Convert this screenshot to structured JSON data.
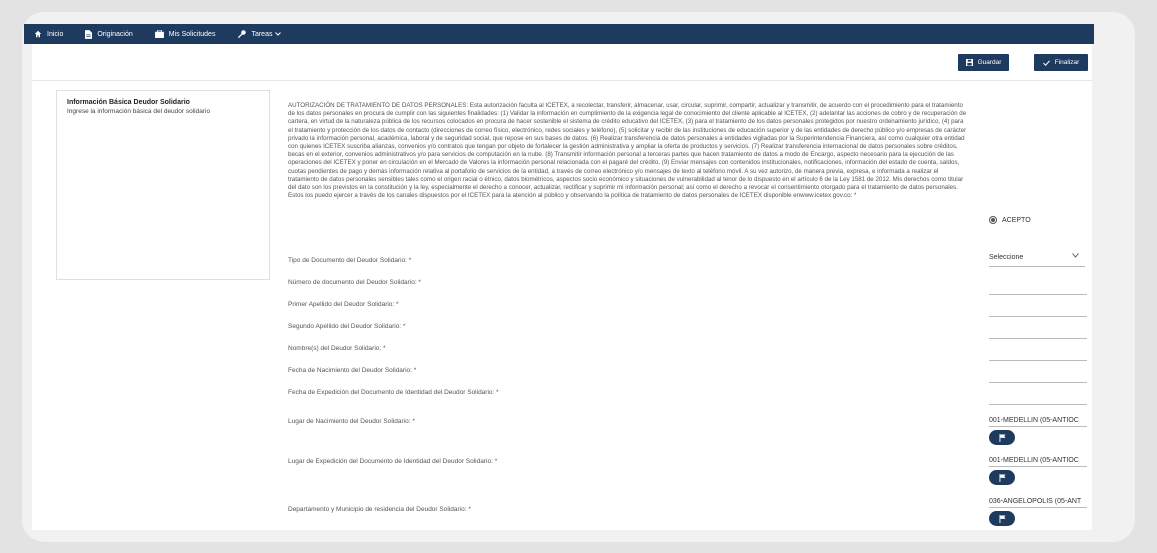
{
  "nav": {
    "items": [
      {
        "label": "Inicio",
        "icon": "home-icon"
      },
      {
        "label": "Originación",
        "icon": "document-icon"
      },
      {
        "label": "Mis Solicitudes",
        "icon": "briefcase-icon"
      },
      {
        "label": "Tareas",
        "icon": "wrench-icon"
      }
    ]
  },
  "toolbar": {
    "save_label": "Guardar",
    "finish_label": "Finalizar"
  },
  "section": {
    "title": "Información Básica Deudor Solidario",
    "subtitle": "Ingrese la información básica del deudor solidario"
  },
  "authorization": {
    "text": "AUTORIZACIÓN DE TRATAMIENTO DE DATOS PERSONALES: Esta autorización faculta al ICETEX, a recolectar, transferir, almacenar, usar, circular, suprimir, compartir, actualizar y transmitir, de acuerdo con el procedimiento para el tratamiento de los datos personales en procura de cumplir con las siguientes finalidades: (1) Validar la información en cumplimiento de la exigencia legal de conocimiento del cliente aplicable al ICETEX, (2) adelantar las acciones de cobro y de recuperación de cartera, en virtud de la naturaleza pública de los recursos colocados en procura de hacer sostenible el sistema de crédito educativo del ICETEX, (3) para el tratamiento de los datos personales protegidos por nuestro ordenamiento jurídico, (4) para el tratamiento y protección de los datos de contacto (direcciones de correo físico, electrónico, redes sociales y teléfono), (5) solicitar y recibir de las instituciones de educación superior y de las entidades de derecho público y/o empresas de carácter privado la información personal, académica, laboral y de seguridad social, que repose en sus bases de datos. (6) Realizar transferencia de datos personales a entidades vigiladas por la Superintendencia Financiera, así como cualquier otra entidad con quienes ICETEX suscriba alianzas, convenios y/o contratos que tengan por objeto de fortalecer la gestión administrativa y ampliar la oferta de productos y servicios. (7) Realizar transferencia internacional de datos personales sobre créditos, becas en el exterior, convenios administrativos y/o para servicios de computación en la nube. (8) Transmitir información personal a terceras partes que hacen tratamiento de datos a modo de Encargo, aspecto necesario para la ejecución de las operaciones del ICETEX y poner en circulación en el Mercado de Valores la información personal relacionada con el pagaré del crédito. (9) Enviar mensajes con contenidos institucionales, notificaciones, información del estado de cuenta, saldos, cuotas pendientes de pago y demás información relativa al portafolio de servicios de la entidad, a través de correo electrónico y/o mensajes de texto al teléfono móvil. A su vez autorizo, de manera previa, expresa, e informada a realizar el tratamiento de datos personales sensibles tales como el origen racial o étnico, datos biométricos, aspectos socio económico y situaciones de vulnerabilidad al tenor de lo dispuesto en el artículo 6 de la Ley 1581 de 2012. Mis derechos como titular del dato son los previstos en la constitución y la ley, especialmente el derecho a conocer, actualizar, rectificar y suprimir mi información personal; así como el derecho a revocar el consentimiento otorgado para el tratamiento de datos personales. Estos los puedo ejercer a través de los canales dispuestos por el ICETEX para la atención al público y observando la política de tratamiento de datos personales de ICETEX disponible enwww.icetex.gov.co: *",
    "accept_label": "ACEPTO"
  },
  "fields": [
    {
      "label": "Tipo de Documento del Deudor Solidario: *",
      "value": "Seleccione"
    },
    {
      "label": "Número de documento del Deudor Solidario: *",
      "value": ""
    },
    {
      "label": "Primer Apellido del Deudor Solidario: *",
      "value": ""
    },
    {
      "label": "Segundo Apellido del Deudor Solidario: *",
      "value": ""
    },
    {
      "label": "Nombre(s) del Deudor Solidario: *",
      "value": ""
    },
    {
      "label": "Fecha de Nacimiento del Deudor Solidario: *",
      "value": ""
    },
    {
      "label": "Fecha de Expedición del Documento de Identidad del Deudor Solidario: *",
      "value": ""
    },
    {
      "label": "Lugar de Nacimiento del Deudor Solidario: *",
      "value": "001-MEDELLIN (05-ANTIOC"
    },
    {
      "label": "Lugar de Expedición del Documento de Identidad del Deudor Solidario: *",
      "value": "001-MEDELLIN (05-ANTIOC"
    },
    {
      "label": "Departamento y Municipio de residencia del Deudor Solidario: *",
      "value": "036-ANGELOPOLIS (05-ANT"
    }
  ],
  "colors": {
    "navy": "#1e3a5f"
  }
}
